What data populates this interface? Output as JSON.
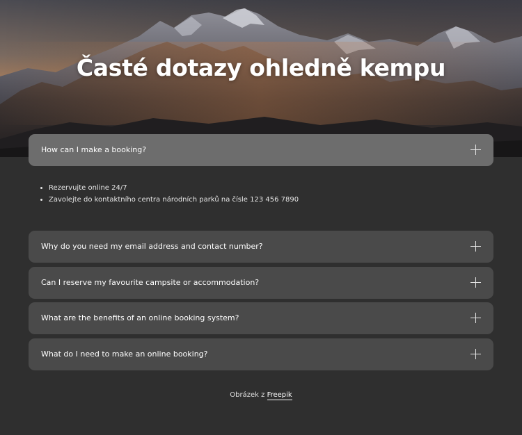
{
  "hero": {
    "title": "Časté dotazy ohledně kempu"
  },
  "faq": {
    "items": [
      {
        "question": "How can I make a booking?",
        "expanded": true,
        "icon": "plus-icon"
      },
      {
        "question": "Why do you need my email address and contact number?",
        "expanded": false,
        "icon": "plus-icon"
      },
      {
        "question": "Can I reserve my favourite campsite or accommodation?",
        "expanded": false,
        "icon": "plus-icon"
      },
      {
        "question": "What are the benefits of an online booking system?",
        "expanded": false,
        "icon": "plus-icon"
      },
      {
        "question": "What do I need to make an online booking?",
        "expanded": false,
        "icon": "plus-icon"
      }
    ],
    "answer": [
      "Rezervujte online 24/7",
      "Zavolejte do kontaktního centra národních parků na čísle 123 456 7890"
    ]
  },
  "credit": {
    "prefix": "Obrázek z",
    "link": "Freepik"
  },
  "colors": {
    "page_background": "#2f2f2f",
    "item_background": "#4a4a4a",
    "item_open_background": "#6d6d6d"
  }
}
